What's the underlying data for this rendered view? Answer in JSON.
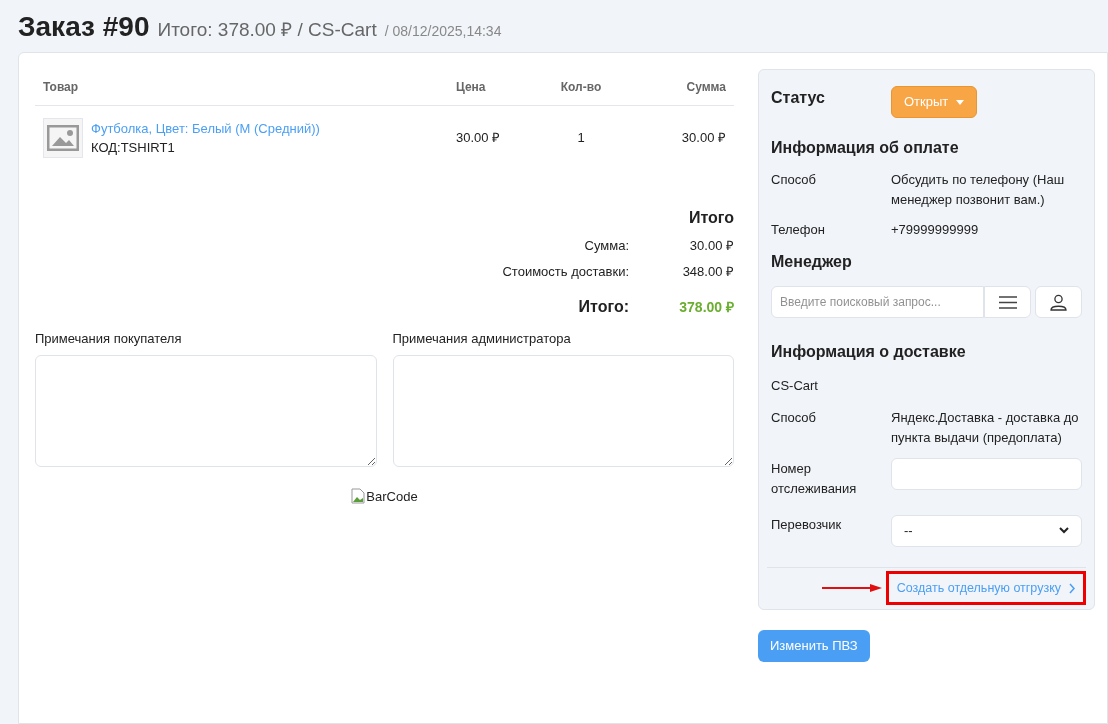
{
  "header": {
    "title": "Заказ #90",
    "summary": "Итого: 378.00 ₽ / CS-Cart",
    "date": "/ 08/12/2025,14:34"
  },
  "products_table": {
    "columns": [
      "Товар",
      "Цена",
      "Кол-во",
      "Сумма"
    ],
    "rows": [
      {
        "name": "Футболка, Цвет: Белый (M (Средний))",
        "code": "КОД:TSHIRT1",
        "price": "30.00 ₽",
        "quantity": "1",
        "sum": "30.00 ₽"
      }
    ]
  },
  "totals": {
    "title": "Итого",
    "lines": [
      {
        "label": "Сумма:",
        "value": "30.00 ₽"
      },
      {
        "label": "Стоимость доставки:",
        "value": "348.00 ₽"
      }
    ],
    "grand_label": "Итого:",
    "grand_value": "378.00 ₽"
  },
  "notes": [
    {
      "label": "Примечания покупателя"
    },
    {
      "label": "Примечания администратора"
    }
  ],
  "barcode": {
    "alt": "BarCode"
  },
  "sidebar": {
    "status": {
      "label": "Статус",
      "value": "Открыт"
    },
    "payment": {
      "title": "Информация об оплате",
      "rows": [
        {
          "label": "Способ",
          "value": "Обсудить по телефону (Наш менеджер позвонит вам.)"
        },
        {
          "label": "Телефон",
          "value": "+79999999999"
        }
      ]
    },
    "manager": {
      "title": "Менеджер",
      "search_placeholder": "Введите поисковый запрос..."
    },
    "shipping": {
      "title": "Информация о доставке",
      "store": "CS-Cart",
      "method_label": "Способ",
      "method_value": "Яндекс.Доставка - доставка до пункта выдачи (предоплата)",
      "tracking_label": "Номер отслеживания",
      "carrier_label": "Перевозчик",
      "carrier_value": "--"
    },
    "shipment_link": {
      "label": "Создать отдельную отгрузку",
      "highlighted": true
    }
  },
  "change_pickup_button": "Изменить ПВЗ"
}
